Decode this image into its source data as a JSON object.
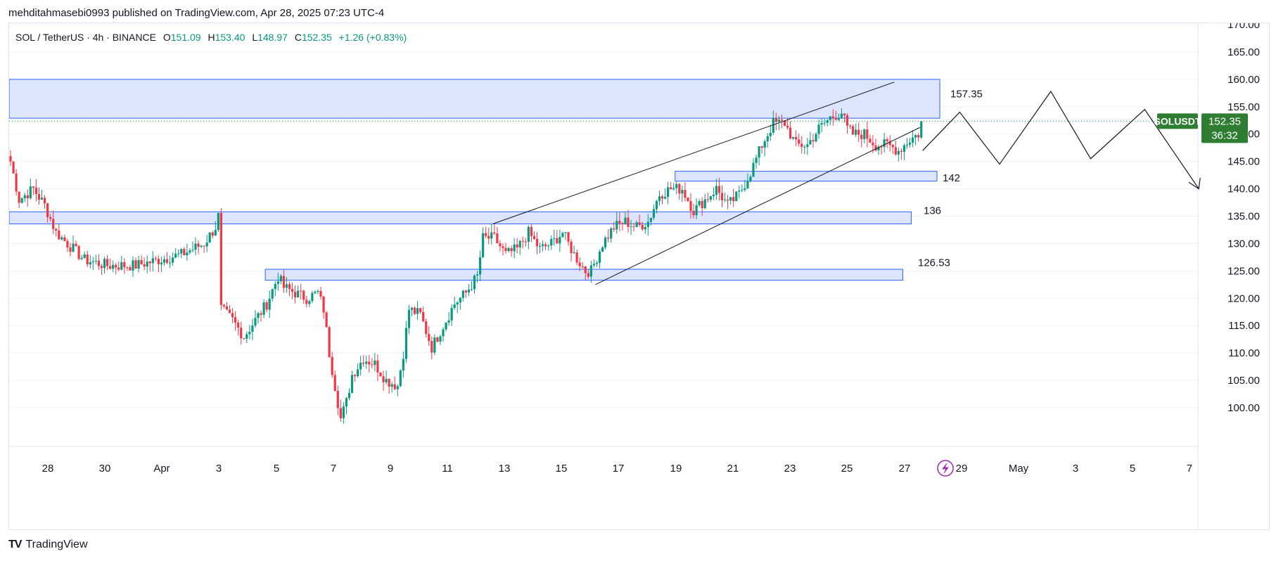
{
  "publish_line": "mehditahmasebi0993 published on TradingView.com, Apr 28, 2025 07:23 UTC-4",
  "legend": {
    "symbol": "SOL / TetherUS · 4h · BINANCE",
    "open_label": "O",
    "open": "151.09",
    "high_label": "H",
    "high": "153.40",
    "low_label": "L",
    "low": "148.97",
    "close_label": "C",
    "close": "152.35",
    "change": "+1.26 (+0.83%)"
  },
  "footer": {
    "logo_text": "TV",
    "brand": "TradingView"
  },
  "colors": {
    "up": "#089981",
    "down": "#f23645",
    "zone_fill": "#d6e0fb",
    "zone_stroke": "#2962ff",
    "grid": "#f0f3fa",
    "text": "#131722",
    "price_tag": "#2e7d32",
    "lightning": "#9c27b0"
  },
  "icons": {
    "lightning": "lightning-icon",
    "logo": "tradingview-logo-icon"
  },
  "chart_data": {
    "type": "candlestick",
    "timeframe": "4h",
    "y_axis": {
      "ticks": [
        "170.00",
        "165.00",
        "160.00",
        "155.00",
        "150.00",
        "145.00",
        "140.00",
        "135.00",
        "130.00",
        "125.00",
        "120.00",
        "115.00",
        "110.00",
        "105.00",
        "100.00"
      ],
      "ylim": [
        95.0,
        171.0
      ]
    },
    "x_axis": {
      "ticks": [
        "28",
        "30",
        "Apr",
        "3",
        "5",
        "7",
        "9",
        "11",
        "13",
        "15",
        "17",
        "19",
        "21",
        "23",
        "25",
        "27",
        "29",
        "May",
        "3",
        "5",
        "7"
      ]
    },
    "last_price": {
      "symbol": "SOLUSDT",
      "price": "152.35",
      "countdown": "36:32"
    },
    "waypoints": [
      [
        0,
        145
      ],
      [
        3,
        138
      ],
      [
        8,
        140
      ],
      [
        12,
        137
      ],
      [
        16,
        132
      ],
      [
        20,
        130
      ],
      [
        26,
        127
      ],
      [
        34,
        126
      ],
      [
        44,
        126
      ],
      [
        52,
        127
      ],
      [
        60,
        128
      ],
      [
        68,
        130
      ],
      [
        72,
        133
      ],
      [
        73,
        135
      ],
      [
        74,
        118
      ],
      [
        78,
        116
      ],
      [
        82,
        113
      ],
      [
        86,
        116
      ],
      [
        90,
        119
      ],
      [
        94,
        124
      ],
      [
        96,
        122
      ],
      [
        100,
        121
      ],
      [
        104,
        120
      ],
      [
        108,
        121
      ],
      [
        110,
        118
      ],
      [
        112,
        110
      ],
      [
        114,
        104
      ],
      [
        116,
        98
      ],
      [
        118,
        101
      ],
      [
        120,
        106
      ],
      [
        124,
        109
      ],
      [
        128,
        108
      ],
      [
        132,
        105
      ],
      [
        136,
        104
      ],
      [
        138,
        110
      ],
      [
        140,
        118
      ],
      [
        144,
        117
      ],
      [
        148,
        111
      ],
      [
        152,
        115
      ],
      [
        156,
        119
      ],
      [
        160,
        121
      ],
      [
        164,
        124
      ],
      [
        166,
        131
      ],
      [
        170,
        131
      ],
      [
        174,
        128
      ],
      [
        178,
        129
      ],
      [
        182,
        132
      ],
      [
        186,
        129
      ],
      [
        190,
        130
      ],
      [
        194,
        132
      ],
      [
        198,
        128
      ],
      [
        202,
        125
      ],
      [
        204,
        125
      ],
      [
        208,
        130
      ],
      [
        212,
        133
      ],
      [
        216,
        134
      ],
      [
        220,
        133
      ],
      [
        224,
        134
      ],
      [
        228,
        139
      ],
      [
        232,
        140
      ],
      [
        236,
        140
      ],
      [
        240,
        136
      ],
      [
        244,
        138
      ],
      [
        248,
        140
      ],
      [
        252,
        137
      ],
      [
        256,
        139
      ],
      [
        260,
        143
      ],
      [
        264,
        148
      ],
      [
        268,
        152
      ],
      [
        272,
        152
      ],
      [
        276,
        148
      ],
      [
        280,
        148
      ],
      [
        284,
        151
      ],
      [
        288,
        153
      ],
      [
        292,
        154
      ],
      [
        294,
        151
      ],
      [
        296,
        150
      ],
      [
        300,
        150
      ],
      [
        304,
        148
      ],
      [
        308,
        148
      ],
      [
        312,
        147
      ],
      [
        316,
        149
      ],
      [
        319,
        150
      ],
      [
        320,
        152.35
      ]
    ],
    "zones": [
      {
        "label": "157.35",
        "from": 152.9,
        "to": 160.0,
        "x_start": 0,
        "x_end": 327
      },
      {
        "label": "142",
        "from": 141.4,
        "to": 143.2,
        "x_start": 234,
        "x_end": 326
      },
      {
        "label": "136",
        "from": 133.6,
        "to": 135.8,
        "x_start": 0,
        "x_end": 317
      },
      {
        "label": "126.53",
        "from": 123.3,
        "to": 125.3,
        "x_start": 90,
        "x_end": 314
      }
    ],
    "channel": {
      "upper": [
        [
          170,
          133.6
        ],
        [
          311,
          159.5
        ]
      ],
      "lower": [
        [
          206,
          122.5
        ],
        [
          320,
          151.2
        ]
      ]
    },
    "projection": [
      [
        321,
        147.0
      ],
      [
        334,
        154.0
      ],
      [
        348,
        144.5
      ],
      [
        366,
        157.8
      ],
      [
        380,
        145.5
      ],
      [
        399,
        154.5
      ],
      [
        418,
        140.0
      ]
    ],
    "projection_arrow": [
      [
        414.5,
        141.2
      ],
      [
        418,
        140.0
      ],
      [
        418.5,
        142.0
      ]
    ]
  }
}
